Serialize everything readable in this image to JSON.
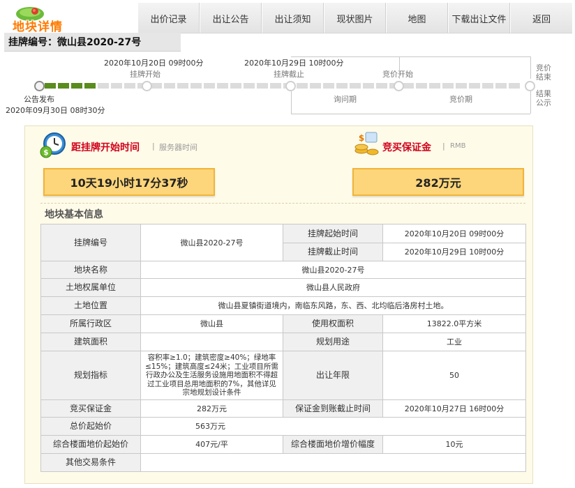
{
  "header": {
    "logo_text": "地块详情",
    "tabs": [
      "出价记录",
      "出让公告",
      "出让须知",
      "现状图片",
      "地图",
      "下载出让文件",
      "返回"
    ],
    "plot_no_text": "挂牌编号：微山县2020-27号"
  },
  "timeline": {
    "listing_start_time": "2020年10月20日 09时00分",
    "listing_start_label": "挂牌开始",
    "listing_end_time": "2020年10月29日 10时00分",
    "listing_end_label": "挂牌截止",
    "bid_start_label": "竞价开始",
    "inquiry_label": "询问期",
    "bidding_label": "竞价期",
    "bid_end_label": "竞价结束",
    "result_label": "结果公示",
    "announce_label": "公告发布",
    "announce_time": "2020年09月30日 08时30分",
    "progress_segments_done": 4
  },
  "countdown": {
    "title": "距挂牌开始时间",
    "subtitle": "服务器时间",
    "value": "10天19小时17分37秒"
  },
  "deposit": {
    "title": "竞买保证金",
    "subtitle": "RMB",
    "value": "282万元"
  },
  "info": {
    "section_title": "地块基本信息",
    "labels": {
      "plot_no": "挂牌编号",
      "listing_start": "挂牌起始时间",
      "listing_end": "挂牌截止时间",
      "plot_name": "地块名称",
      "owner": "土地权属单位",
      "location": "土地位置",
      "district": "所属行政区",
      "use_area": "使用权面积",
      "build_area": "建筑面积",
      "land_use": "规划用途",
      "plan_index": "规划指标",
      "term": "出让年限",
      "deposit": "竞买保证金",
      "deposit_deadline": "保证金到账截止时间",
      "start_price": "总价起始价",
      "floor_price": "综合楼面地价起始价",
      "floor_increment": "综合楼面地价增价幅度",
      "other": "其他交易条件"
    },
    "values": {
      "plot_no": "微山县2020-27号",
      "listing_start": "2020年10月20日 09时00分",
      "listing_end": "2020年10月29日 10时00分",
      "plot_name": "微山县2020-27号",
      "owner": "微山县人民政府",
      "location": "微山县夏镇街道境内，南临东风路，东、西、北均临后洛房村土地。",
      "district": "微山县",
      "use_area": "13822.0平方米",
      "build_area": "",
      "land_use": "工业",
      "plan_index": "容积率≥1.0；建筑密度≥40%；绿地率≤15%；建筑高度≤24米；工业项目所需行政办公及生活服务设施用地面积不得超过工业项目总用地面积的7%，其他详见宗地规划设计条件",
      "term": "50",
      "deposit": "282万元",
      "deposit_deadline": "2020年10月27日 16时00分",
      "start_price": "563万元",
      "floor_price": "407元/平",
      "floor_increment": "10元",
      "other": ""
    }
  },
  "colors": {
    "accent_orange": "#ff7a00",
    "heading_red": "#d0021b",
    "progress_green": "#5a8c1e",
    "box_yellow": "#fdd57a",
    "panel_bg": "#fffbe9"
  }
}
